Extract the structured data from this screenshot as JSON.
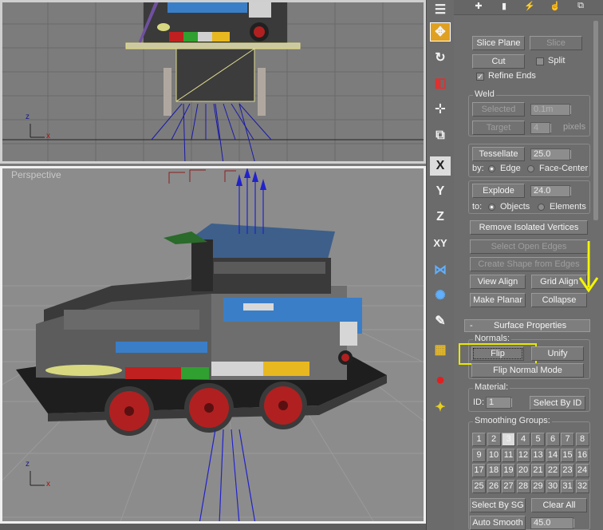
{
  "viewports": {
    "top": {
      "label": ""
    },
    "perspective": {
      "label": "Perspective"
    }
  },
  "axes": {
    "top": {
      "x": "x",
      "z": "z"
    },
    "persp": {
      "x": "x",
      "z": "z"
    }
  },
  "toolstrip": {
    "x_label": "X",
    "y_label": "Y",
    "z_label": "Z",
    "xy_label": "XY"
  },
  "tabs": [
    "✚",
    "▮",
    "⚡",
    "☝",
    "⧉"
  ],
  "edit_geometry": {
    "slice_plane": "Slice Plane",
    "slice": "Slice",
    "cut": "Cut",
    "split": "Split",
    "refine_ends": "Refine Ends",
    "weld_label": "Weld",
    "selected": "Selected",
    "weld_threshold": "0.1m",
    "target": "Target",
    "target_pixels": "4",
    "pixels": "pixels",
    "tessellate": "Tessellate",
    "tessellate_value": "25.0",
    "by": "by:",
    "edge": "Edge",
    "face_center": "Face-Center",
    "explode": "Explode",
    "explode_value": "24.0",
    "to": "to:",
    "objects": "Objects",
    "elements": "Elements",
    "remove_isolated_vertices": "Remove Isolated Vertices",
    "select_open_edges": "Select Open Edges",
    "create_shape_from_edges": "Create Shape from Edges",
    "view_align": "View Align",
    "grid_align": "Grid Align",
    "make_planar": "Make Planar",
    "collapse": "Collapse"
  },
  "surface_properties": {
    "collapse_sign": "-",
    "title": "Surface Properties",
    "normals_label": "Normals:",
    "flip": "Flip",
    "unify": "Unify",
    "flip_normal_mode": "Flip Normal Mode",
    "material_label": "Material:",
    "id_label": "ID:",
    "id_value": "1",
    "select_by_id": "Select By ID",
    "smoothing_groups_label": "Smoothing Groups:",
    "smoothing_groups": [
      "1",
      "2",
      "3",
      "4",
      "5",
      "6",
      "7",
      "8",
      "9",
      "10",
      "11",
      "12",
      "13",
      "14",
      "15",
      "16",
      "17",
      "18",
      "19",
      "20",
      "21",
      "22",
      "23",
      "24",
      "25",
      "26",
      "27",
      "28",
      "29",
      "30",
      "31",
      "32"
    ],
    "active_group": "3",
    "select_by_sg": "Select By SG",
    "clear_all": "Clear All",
    "auto_smooth": "Auto Smooth",
    "auto_smooth_value": "45.0"
  },
  "colors": {
    "highlight": "#e8e800",
    "arrow": "#f5f500",
    "normals": "#2222cc"
  }
}
